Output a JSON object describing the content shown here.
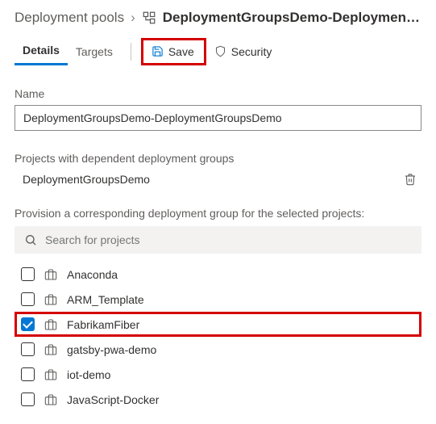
{
  "breadcrumb": {
    "parent": "Deployment pools",
    "current": "DeploymentGroupsDemo-Deployment..."
  },
  "tabs": {
    "details": "Details",
    "targets": "Targets"
  },
  "toolbar": {
    "save": "Save",
    "security": "Security"
  },
  "name_section": {
    "label": "Name",
    "value": "DeploymentGroupsDemo-DeploymentGroupsDemo"
  },
  "dependent": {
    "label": "Projects with dependent deployment groups",
    "items": [
      "DeploymentGroupsDemo"
    ]
  },
  "provision": {
    "label": "Provision a corresponding deployment group for the selected projects:",
    "search_placeholder": "Search for projects",
    "projects": [
      {
        "name": "Anaconda",
        "checked": false
      },
      {
        "name": "ARM_Template",
        "checked": false
      },
      {
        "name": "FabrikamFiber",
        "checked": true
      },
      {
        "name": "gatsby-pwa-demo",
        "checked": false
      },
      {
        "name": "iot-demo",
        "checked": false
      },
      {
        "name": "JavaScript-Docker",
        "checked": false
      }
    ]
  }
}
